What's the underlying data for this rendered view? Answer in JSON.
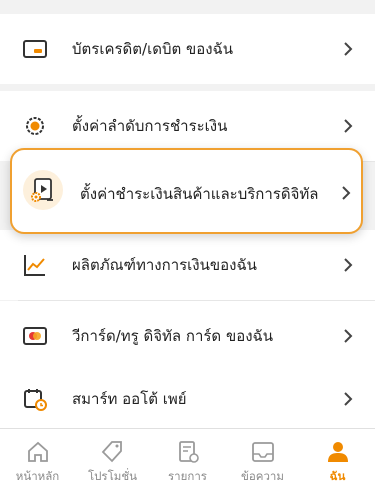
{
  "menu": {
    "cards": "บัตรเครดิต/เดบิต ของฉัน",
    "payment_settings": "ตั้งค่าลำดับการชำระเงิน",
    "digital_payment_settings": "ตั้งค่าชำระเงินสินค้าและบริการดิจิทัล",
    "finance_products": "ผลิตภัณฑ์ทางการเงินของฉัน",
    "true_card": "วีการ์ด/ทรู ดิจิทัล การ์ด ของฉัน",
    "smart_auto_pay": "สมาร์ท ออโต้ เพย์"
  },
  "tabs": {
    "home": "หน้าหลัก",
    "promotions": "โปรโมชั่น",
    "transactions": "รายการ",
    "messages": "ข้อความ",
    "me": "ฉัน"
  },
  "colors": {
    "accent": "#f08a00",
    "highlight_border": "#f0a030"
  }
}
